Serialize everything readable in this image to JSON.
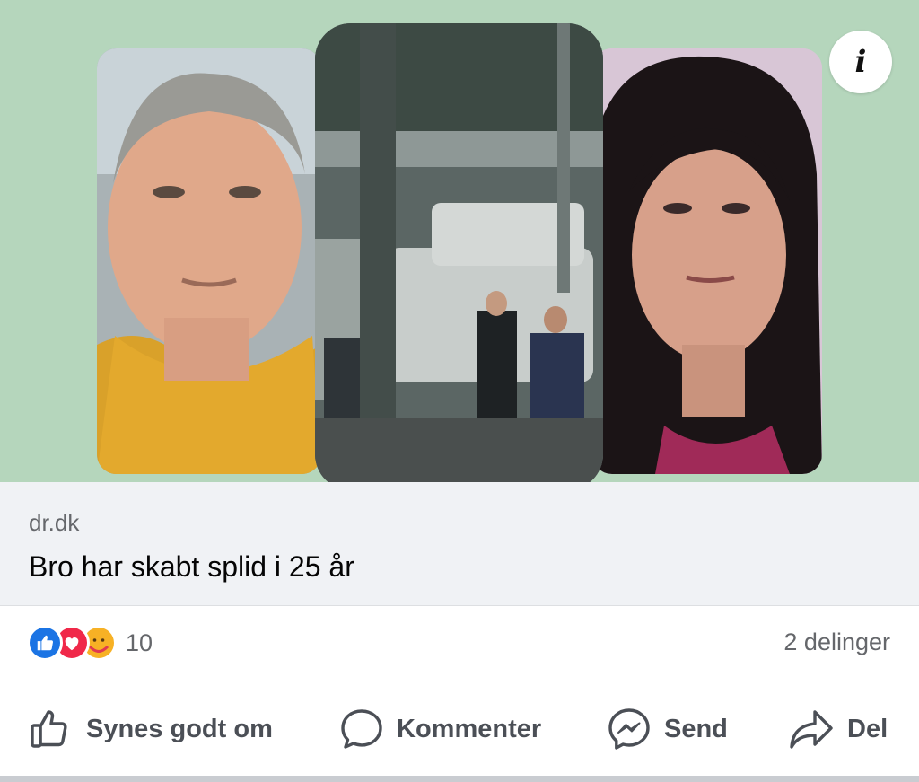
{
  "post": {
    "info_icon": "info-icon",
    "link": {
      "domain": "dr.dk",
      "headline": "Bro har skabt splid i 25 år"
    },
    "stats": {
      "reaction_icons": [
        "like-reaction-icon",
        "love-reaction-icon",
        "care-reaction-icon"
      ],
      "reaction_count": "10",
      "shares": "2 delinger"
    },
    "actions": {
      "like": "Synes godt om",
      "comment": "Kommenter",
      "send": "Send",
      "share": "Del"
    },
    "colors": {
      "hero_background": "#b5d6bc",
      "like_blue": "#1b74e4",
      "love_red": "#f02849",
      "care_yellow": "#f7b125",
      "secondary_text": "#65676b"
    }
  }
}
